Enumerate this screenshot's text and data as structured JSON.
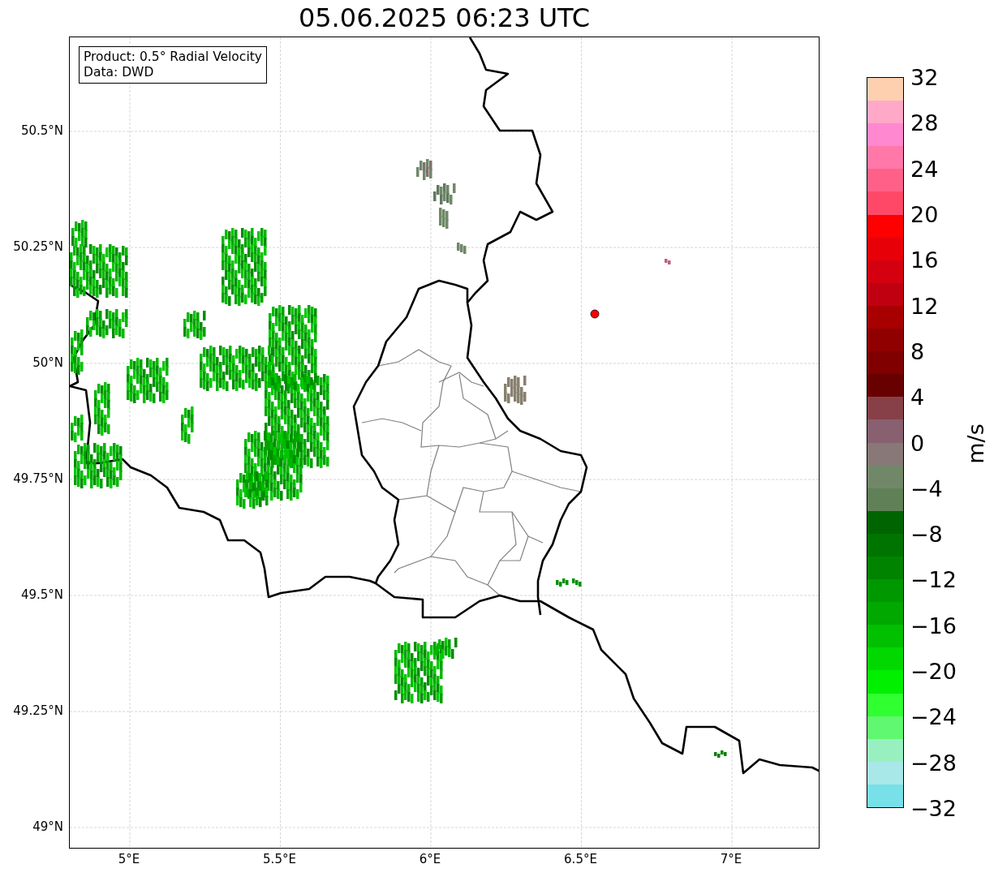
{
  "title": "05.06.2025 06:23 UTC",
  "map": {
    "legend": [
      "Product: 0.5° Radial Velocity",
      "Data: DWD"
    ],
    "x_ticks": [
      "5°E",
      "5.5°E",
      "6°E",
      "6.5°E",
      "7°E"
    ],
    "y_ticks": [
      "50.5°N",
      "50.25°N",
      "50°N",
      "49.75°N",
      "49.5°N",
      "49.25°N",
      "49°N"
    ]
  },
  "colorbar": {
    "label": "m/s",
    "ticks": [
      "32",
      "28",
      "24",
      "20",
      "16",
      "12",
      "8",
      "4",
      "0",
      "−4",
      "−8",
      "−12",
      "−16",
      "−20",
      "−24",
      "−28",
      "−32"
    ],
    "bins": [
      {
        "color": "#ffd0b0"
      },
      {
        "color": "#ffa8c8"
      },
      {
        "color": "#ff88d0"
      },
      {
        "color": "#ff78a8"
      },
      {
        "color": "#ff6088"
      },
      {
        "color": "#ff4868"
      },
      {
        "color": "#ff0000"
      },
      {
        "color": "#e80008"
      },
      {
        "color": "#d40010"
      },
      {
        "color": "#c00010"
      },
      {
        "color": "#a80000"
      },
      {
        "color": "#900000"
      },
      {
        "color": "#800000"
      },
      {
        "color": "#680000"
      },
      {
        "color": "#884048"
      },
      {
        "color": "#886070"
      },
      {
        "color": "#887878"
      },
      {
        "color": "#708868"
      },
      {
        "color": "#608058"
      },
      {
        "color": "#006400"
      },
      {
        "color": "#007400"
      },
      {
        "color": "#008400"
      },
      {
        "color": "#009800"
      },
      {
        "color": "#00a800"
      },
      {
        "color": "#00c000"
      },
      {
        "color": "#00d800"
      },
      {
        "color": "#00f000"
      },
      {
        "color": "#30ff30"
      },
      {
        "color": "#60f870"
      },
      {
        "color": "#98f0c0"
      },
      {
        "color": "#a8e8e8"
      },
      {
        "color": "#78e0e8"
      }
    ]
  }
}
